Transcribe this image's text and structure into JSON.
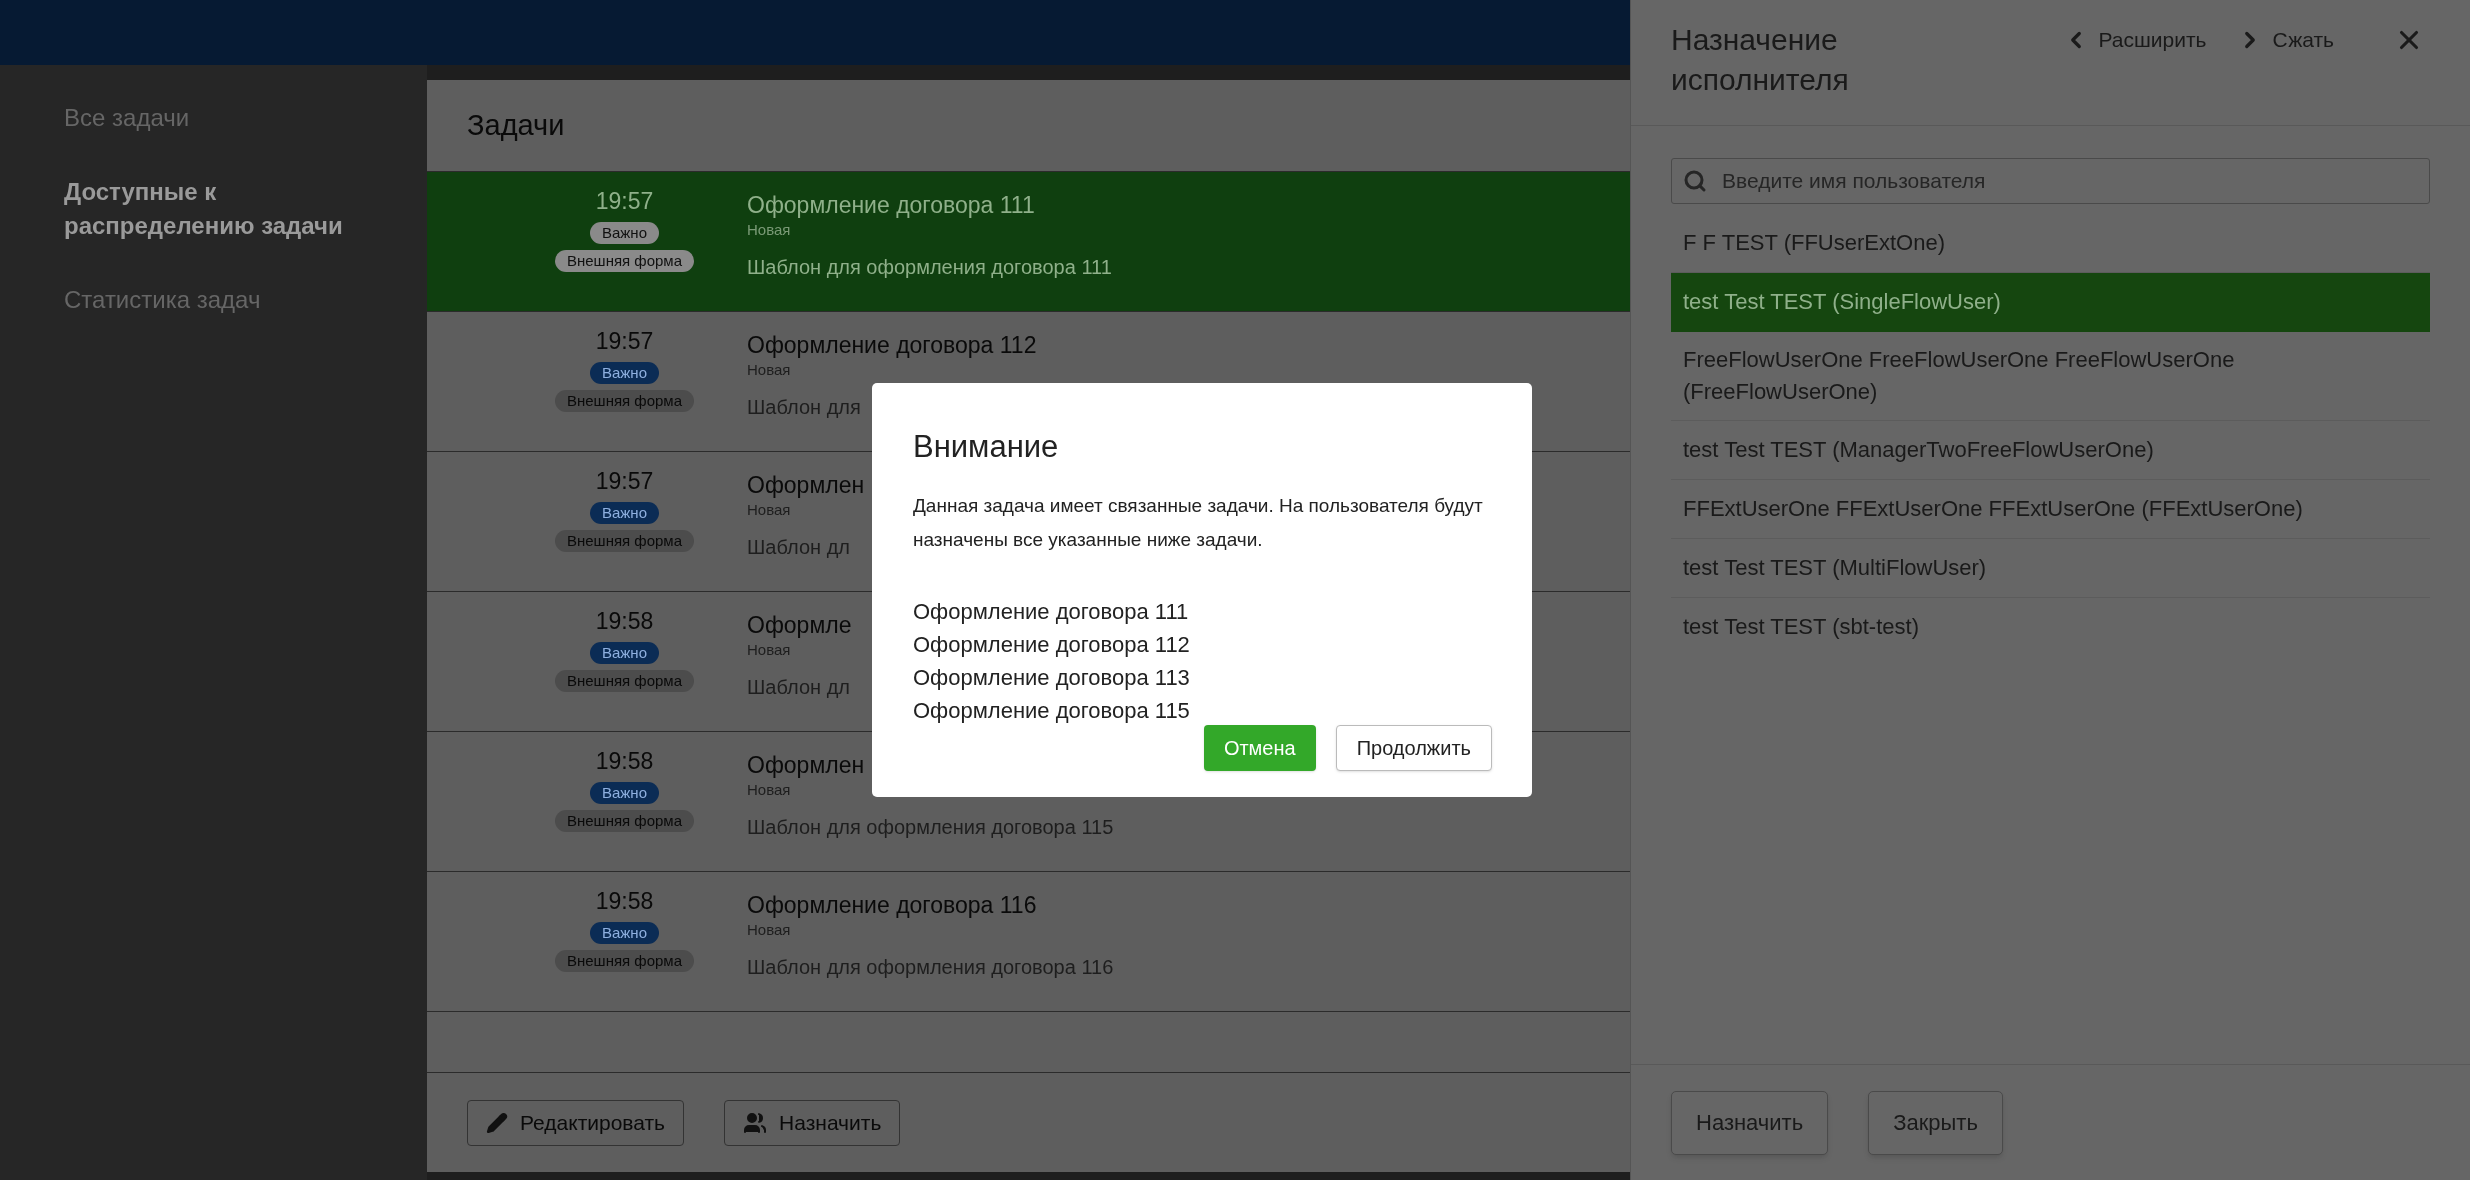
{
  "sidebar": {
    "items": [
      {
        "label": "Все задачи",
        "selected": false
      },
      {
        "label": "Доступные к распределению задачи",
        "selected": true
      },
      {
        "label": "Статистика задач",
        "selected": false
      }
    ]
  },
  "tasks": {
    "title": "Задачи",
    "rows": [
      {
        "time": "19:57",
        "badges": [
          "Важно",
          "Внешняя форма"
        ],
        "title": "Оформление договора 111",
        "status": "Новая",
        "template": "Шаблон для оформления договора 111",
        "selected": true
      },
      {
        "time": "19:57",
        "badges": [
          "Важно",
          "Внешняя форма"
        ],
        "title": "Оформление договора 112",
        "status": "Новая",
        "template": "Шаблон для",
        "selected": false
      },
      {
        "time": "19:57",
        "badges": [
          "Важно",
          "Внешняя форма"
        ],
        "title": "Оформлен",
        "status": "Новая",
        "template": "Шаблон дл",
        "selected": false
      },
      {
        "time": "19:58",
        "badges": [
          "Важно",
          "Внешняя форма"
        ],
        "title": "Оформле",
        "status": "Новая",
        "template": "Шаблон дл",
        "selected": false
      },
      {
        "time": "19:58",
        "badges": [
          "Важно",
          "Внешняя форма"
        ],
        "title": "Оформлен",
        "status": "Новая",
        "template": "Шаблон для оформления договора 115",
        "selected": false
      },
      {
        "time": "19:58",
        "badges": [
          "Важно",
          "Внешняя форма"
        ],
        "title": "Оформление договора 116",
        "status": "Новая",
        "template": "Шаблон для оформления договора 116",
        "selected": false
      }
    ],
    "buttons": [
      {
        "label": "Редактировать",
        "kind": "edit"
      },
      {
        "label": "Назначить",
        "kind": "assign"
      }
    ]
  },
  "assign_panel": {
    "title": "Назначение исполнителя",
    "expand": "Расширить",
    "collapse": "Сжать",
    "search": {
      "placeholder": "Введите имя пользователя"
    },
    "users": [
      {
        "name": "F F TEST (FFUserExtOne)",
        "selected": false
      },
      {
        "name": "test Test TEST (SingleFlowUser)",
        "selected": true
      },
      {
        "name": "FreeFlowUserOne FreeFlowUserOne FreeFlowUserOne (FreeFlowUserOne)",
        "selected": false
      },
      {
        "name": "test Test TEST (ManagerTwoFreeFlowUserOne)",
        "selected": false
      },
      {
        "name": "FFExtUserOne FFExtUserOne FFExtUserOne (FFExtUserOne)",
        "selected": false
      },
      {
        "name": "test Test TEST (MultiFlowUser)",
        "selected": false
      },
      {
        "name": "test Test TEST (sbt-test)",
        "selected": false
      }
    ],
    "buttons": [
      "Назначить",
      "Закрыть"
    ]
  },
  "dialog": {
    "title": "Внимание",
    "message": "Данная задача имеет связанные задачи. На пользователя будут назначены все указанные ниже задачи.",
    "tasks": [
      "Оформление договора 111",
      "Оформление договора 112",
      "Оформление договора 113",
      "Оформление договора 115"
    ],
    "buttons": [
      {
        "label": "Отмена",
        "kind": "primary"
      },
      {
        "label": "Продолжить",
        "kind": "secondary"
      }
    ]
  }
}
